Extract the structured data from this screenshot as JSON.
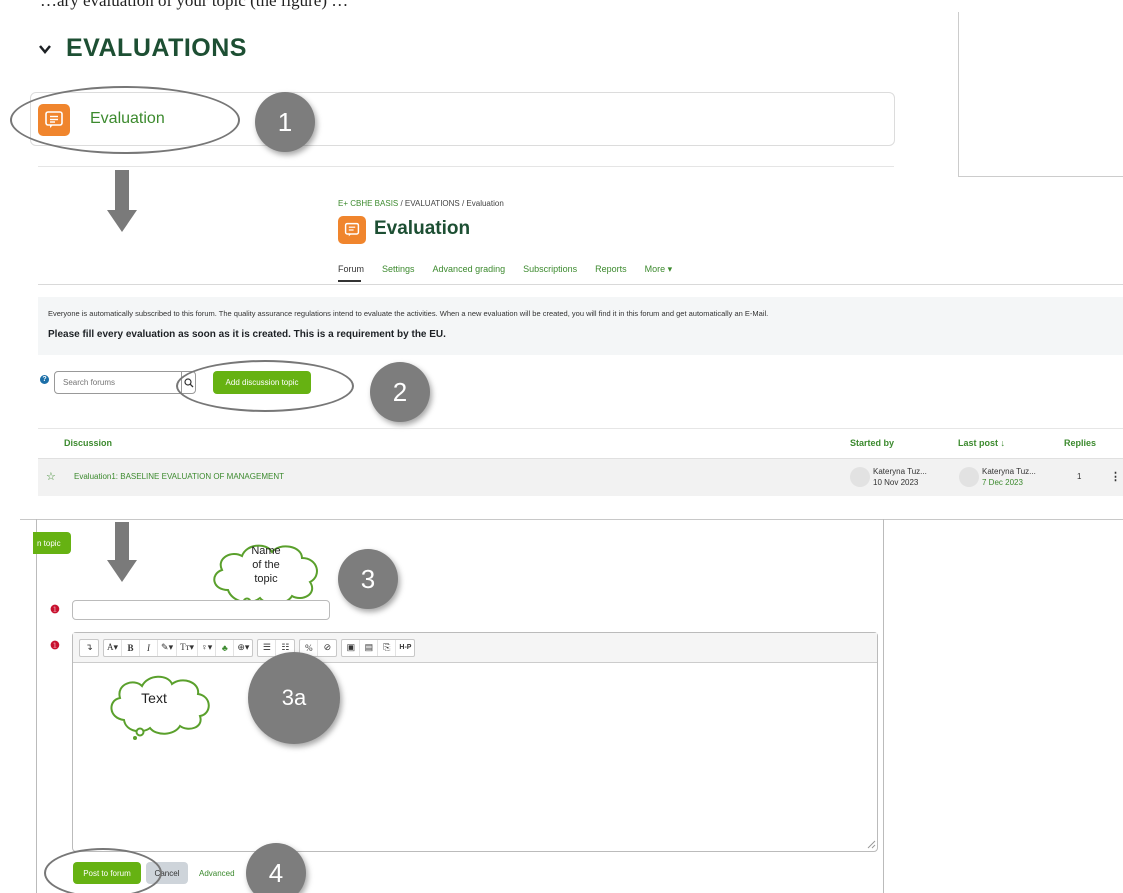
{
  "top_fragment": "…ary evaluation of your topic (the figure) …",
  "section": {
    "title": "EVALUATIONS"
  },
  "activity": {
    "name": "Evaluation"
  },
  "steps": {
    "s1": "1",
    "s2": "2",
    "s3": "3",
    "s3a": "3a",
    "s4": "4"
  },
  "breadcrumb": {
    "course": "E+ CBHE BASIS",
    "sep1": " / ",
    "section": "EVALUATIONS",
    "sep2": " / ",
    "current": "Evaluation"
  },
  "page": {
    "title": "Evaluation"
  },
  "tabs": [
    {
      "label": "Forum"
    },
    {
      "label": "Settings"
    },
    {
      "label": "Advanced grading"
    },
    {
      "label": "Subscriptions"
    },
    {
      "label": "Reports"
    },
    {
      "label": "More ▾"
    }
  ],
  "notice": {
    "line1": "Everyone is automatically subscribed to this forum. The quality assurance regulations intend to evaluate the activities. When a new evaluation will be created, you will find it in this forum and get automatically an E-Mail.",
    "line2": "Please fill every evaluation as soon as it is created. This is a requirement by the EU."
  },
  "search": {
    "placeholder": "Search forums"
  },
  "buttons": {
    "add_topic": "Add discussion topic",
    "topic_cut": "n topic",
    "post": "Post to forum",
    "cancel": "Cancel",
    "advanced": "Advanced"
  },
  "table": {
    "headers": {
      "discussion": "Discussion",
      "started_by": "Started by",
      "last_post": "Last post ↓",
      "replies": "Replies"
    },
    "rows": [
      {
        "title": "Evaluation1: BASELINE EVALUATION OF MANAGEMENT",
        "started_name": "Kateryna Tuz...",
        "started_date": "10 Nov 2023",
        "last_name": "Kateryna Tuz...",
        "last_date": "7 Dec 2023",
        "replies": "1"
      }
    ]
  },
  "callouts": {
    "topic_l1": "Name",
    "topic_l2": "of the",
    "topic_l3": "topic",
    "text": "Text"
  },
  "toolbar": {
    "g1": [
      "↴"
    ],
    "g2": [
      "A▾",
      "B",
      "I",
      "✎▾",
      "Tт▾",
      "♀▾",
      "♣",
      "⊕▾"
    ],
    "g3": [
      "☰",
      "☷"
    ],
    "g4": [
      "%",
      "⊘"
    ],
    "g5": [
      "▣",
      "▤",
      "⎘",
      "H-P"
    ]
  },
  "colors": {
    "accent_green": "#66b212",
    "link_green": "#3c8a2e",
    "title_green": "#1d4f33",
    "forum_orange": "#f0852d",
    "step_grey": "#7d7d7d"
  }
}
